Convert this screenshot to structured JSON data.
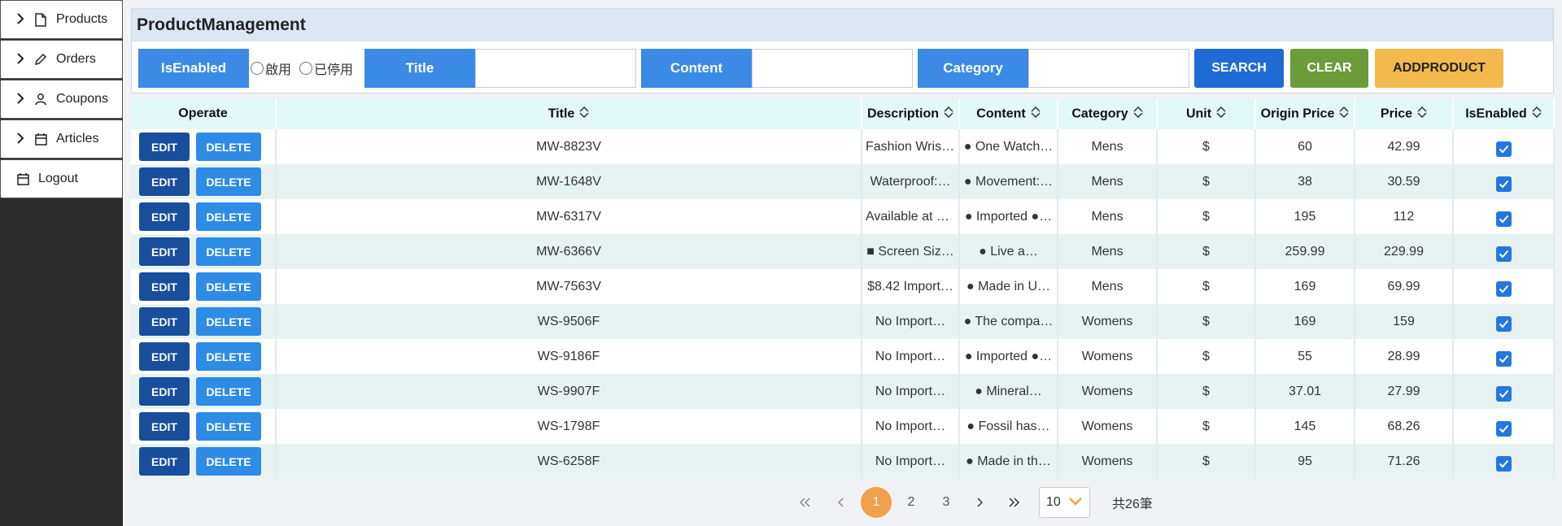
{
  "sidebar": {
    "items": [
      {
        "label": "Products",
        "icon": "document-icon"
      },
      {
        "label": "Orders",
        "icon": "pencil-icon"
      },
      {
        "label": "Coupons",
        "icon": "user-icon"
      },
      {
        "label": "Articles",
        "icon": "calendar-icon"
      }
    ],
    "logout": {
      "label": "Logout",
      "icon": "calendar-icon"
    }
  },
  "header": {
    "title": "ProductManagement"
  },
  "filters": {
    "isenabled_label": "IsEnabled",
    "radio_enabled": "啟用",
    "radio_disabled": "已停用",
    "title_label": "Title",
    "title_value": "",
    "content_label": "Content",
    "content_value": "",
    "category_label": "Category",
    "category_value": "",
    "search_button": "SEARCH",
    "clear_button": "CLEAR",
    "add_button": "ADDPRODUCT"
  },
  "table": {
    "columns": [
      "Operate",
      "Title",
      "Description",
      "Content",
      "Category",
      "Unit",
      "Origin Price",
      "Price",
      "IsEnabled"
    ],
    "edit_label": "EDIT",
    "delete_label": "DELETE",
    "rows": [
      {
        "title": "MW-8823V",
        "description": "Fashion Wrist…",
        "content": "● One Watch…",
        "category": "Mens",
        "unit": "$",
        "origin_price": "60",
        "price": "42.99",
        "enabled": true
      },
      {
        "title": "MW-1648V",
        "description": "Waterproof:…",
        "content": "● Movement:…",
        "category": "Mens",
        "unit": "$",
        "origin_price": "38",
        "price": "30.59",
        "enabled": true
      },
      {
        "title": "MW-6317V",
        "description": "Available at a…",
        "content": "● Imported ●…",
        "category": "Mens",
        "unit": "$",
        "origin_price": "195",
        "price": "112",
        "enabled": true
      },
      {
        "title": "MW-6366V",
        "description": "■ Screen Siz…",
        "content": "● Live a…",
        "category": "Mens",
        "unit": "$",
        "origin_price": "259.99",
        "price": "229.99",
        "enabled": true
      },
      {
        "title": "MW-7563V",
        "description": "$8.42 Import…",
        "content": "● Made in U…",
        "category": "Mens",
        "unit": "$",
        "origin_price": "169",
        "price": "69.99",
        "enabled": true
      },
      {
        "title": "WS-9506F",
        "description": "No Import…",
        "content": "● The compa…",
        "category": "Womens",
        "unit": "$",
        "origin_price": "169",
        "price": "159",
        "enabled": true
      },
      {
        "title": "WS-9186F",
        "description": "No Import…",
        "content": "● Imported ●…",
        "category": "Womens",
        "unit": "$",
        "origin_price": "55",
        "price": "28.99",
        "enabled": true
      },
      {
        "title": "WS-9907F",
        "description": "No Import…",
        "content": "● Mineral…",
        "category": "Womens",
        "unit": "$",
        "origin_price": "37.01",
        "price": "27.99",
        "enabled": true
      },
      {
        "title": "WS-1798F",
        "description": "No Import…",
        "content": "● Fossil has…",
        "category": "Womens",
        "unit": "$",
        "origin_price": "145",
        "price": "68.26",
        "enabled": true
      },
      {
        "title": "WS-6258F",
        "description": "No Import…",
        "content": "● Made in th…",
        "category": "Womens",
        "unit": "$",
        "origin_price": "95",
        "price": "71.26",
        "enabled": true
      }
    ]
  },
  "pagination": {
    "first": "«",
    "prev": "‹",
    "pages": [
      "1",
      "2",
      "3"
    ],
    "current": "1",
    "next": "›",
    "last": "»",
    "page_size": "10",
    "total": "共26筆"
  },
  "colors": {
    "sidebar_bg": "#2b2b2b",
    "label_blue": "#3b8ae6",
    "search": "#1f6bd6",
    "clear": "#6a9c3a",
    "add": "#f4b94d",
    "edit": "#184e9c",
    "delete": "#2e8be6",
    "header_row": "#e3f8f8",
    "active_page": "#f0a04b"
  }
}
